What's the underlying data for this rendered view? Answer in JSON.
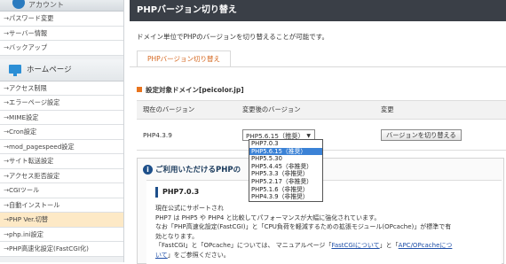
{
  "sidebar": {
    "account_label": "アカウント",
    "account_items": [
      {
        "label": "パスワード変更"
      },
      {
        "label": "サーバー情報"
      },
      {
        "label": "バックアップ"
      }
    ],
    "homepage_label": "ホームページ",
    "homepage_items": [
      {
        "label": "アクセス制限"
      },
      {
        "label": "エラーページ設定"
      },
      {
        "label": "MIME設定"
      },
      {
        "label": "Cron設定"
      },
      {
        "label": "mod_pagespeed設定"
      },
      {
        "label": "サイト転送設定"
      },
      {
        "label": "アクセス拒否設定"
      },
      {
        "label": "CGIツール"
      },
      {
        "label": "自動インストール"
      },
      {
        "label": "PHP Ver.切替"
      },
      {
        "label": "php.ini設定"
      },
      {
        "label": "PHP高速化設定(FastCGI化)"
      }
    ],
    "arrow": "→"
  },
  "main": {
    "title": "PHPバージョン切り替え",
    "description": "ドメイン単位でPHPのバージョンを切り替えることが可能です。",
    "tab_label": "PHPバージョン切り替え",
    "target_label": "設定対象ドメイン[peicolor.jp]",
    "table": {
      "headers": [
        "現在のバージョン",
        "変更後のバージョン",
        "変更"
      ],
      "current_version": "PHP4.3.9",
      "selected_version": "PHP5.6.15（推奨）",
      "change_button": "バージョンを切り替える"
    },
    "dropdown_options": [
      "PHP7.0.3",
      "PHP5.6.15（推奨）",
      "PHP5.5.30",
      "PHP5.4.45（非推奨）",
      "PHP5.3.3（非推奨）",
      "PHP5.2.17（非推奨）",
      "PHP5.1.6（非推奨）",
      "PHP4.3.9（非推奨）"
    ],
    "info": {
      "heading": "ご利用いただけるPHPの",
      "version_heading": "PHP7.0.3",
      "line1": "現在公式にサポートされ",
      "line2": "PHP7 は PHP5 や PHP4 と比較してパフォーマンスが大幅に強化されています。",
      "line3": "なお「PHP高速化設定(FastCGI)」と「CPU負荷を軽減するための拡張モジュール(OPcache)」が標準で有",
      "line4": "効となります。",
      "line5_pre": "「FastCGI」と「OPcache」については、 マニュアルページ「",
      "link1": "FastCGIについて",
      "line5_mid": "」と「",
      "link2": "APC/OPcacheにつ",
      "line6_link": "いて",
      "line6_post": "」をご参照ください。"
    }
  },
  "colors": {
    "title_bar": "#3a3f47",
    "accent_orange": "#d5671f",
    "link_blue": "#1f4fa8",
    "dropdown_highlight": "#3b82d6",
    "active_sidebar": "#fde9c6"
  }
}
